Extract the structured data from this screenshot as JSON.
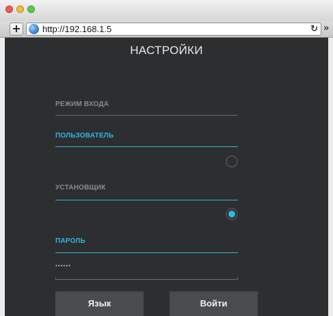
{
  "browser": {
    "url": "http://192.168.1.5",
    "new_tab_glyph": "+",
    "reload_glyph": "↻",
    "overflow_glyph": "»"
  },
  "app": {
    "title": "НАСТРОЙКИ",
    "login_mode_label": "РЕЖИМ ВХОДА",
    "user_option": {
      "label": "ПОЛЬЗОВАТЕЛЬ",
      "selected": false
    },
    "installer_option": {
      "label": "УСТАНОВЩИК",
      "selected": true
    },
    "password": {
      "label": "ПАРОЛЬ",
      "value": "••••••"
    },
    "buttons": {
      "language": "Язык",
      "login": "Войти"
    },
    "colors": {
      "accent": "#33b5e5",
      "background": "#2d2e30",
      "button": "#4a4b4d"
    }
  }
}
